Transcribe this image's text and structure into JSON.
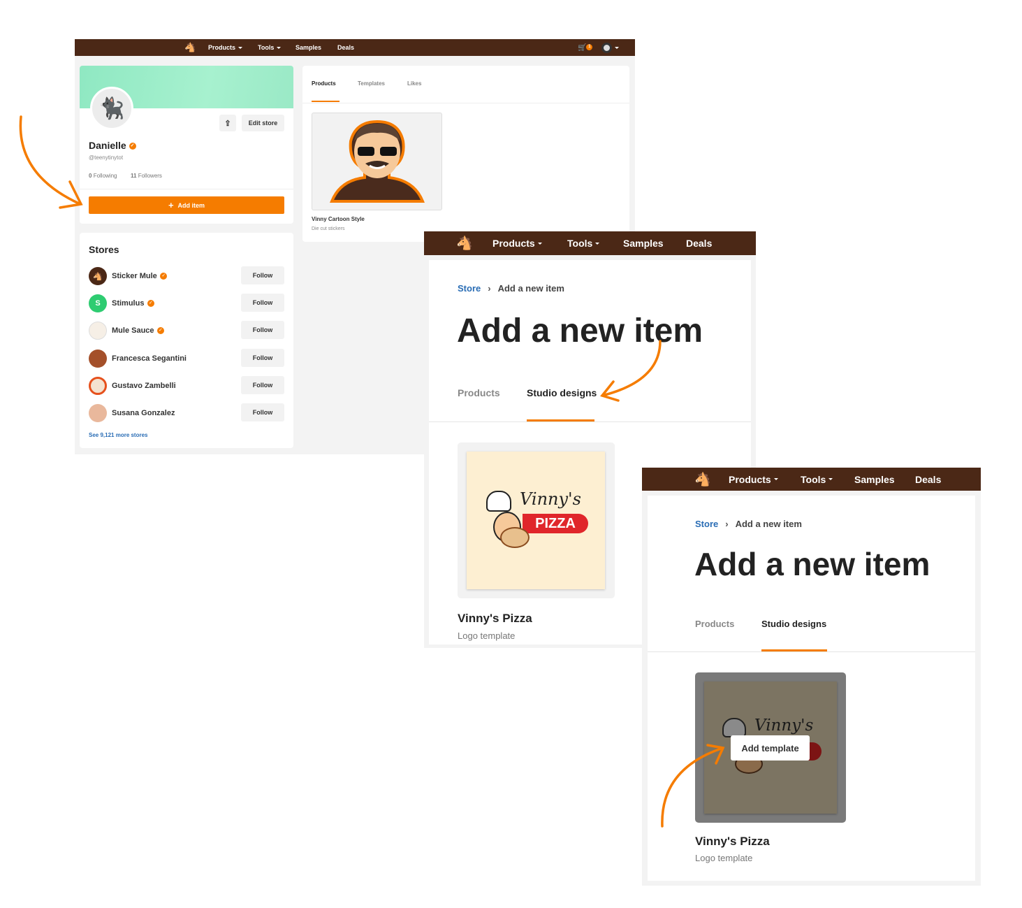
{
  "nav": {
    "items": [
      "Products",
      "Tools",
      "Samples",
      "Deals"
    ],
    "cart_count": "1",
    "brand_color": "#4b2816",
    "accent_color": "#f57c00"
  },
  "profile": {
    "name": "Danielle",
    "handle": "@teenytinytot",
    "following_count": "0",
    "following_label": "Following",
    "followers_count": "11",
    "followers_label": "Followers",
    "edit_store_label": "Edit store",
    "add_item_label": "Add item"
  },
  "stores": {
    "title": "Stores",
    "items": [
      {
        "name": "Sticker Mule",
        "verified": true,
        "follow_label": "Follow"
      },
      {
        "name": "Stimulus",
        "verified": true,
        "follow_label": "Follow"
      },
      {
        "name": "Mule Sauce",
        "verified": true,
        "follow_label": "Follow"
      },
      {
        "name": "Francesca Segantini",
        "verified": false,
        "follow_label": "Follow"
      },
      {
        "name": "Gustavo Zambelli",
        "verified": false,
        "follow_label": "Follow"
      },
      {
        "name": "Susana Gonzalez",
        "verified": false,
        "follow_label": "Follow"
      }
    ],
    "more_link": "See 9,121 more stores"
  },
  "store_tabs": {
    "tabs": [
      "Products",
      "Templates",
      "Likes"
    ],
    "active": "Products"
  },
  "product": {
    "title": "Vinny Cartoon Style",
    "subtitle": "Die cut stickers"
  },
  "add_item_page": {
    "breadcrumb_store": "Store",
    "breadcrumb_current": "Add a new item",
    "title": "Add a new item",
    "tabs": [
      "Products",
      "Studio designs"
    ],
    "active_tab": "Studio designs",
    "template": {
      "title": "Vinny's Pizza",
      "subtitle": "Logo template",
      "logo_script": "Vinny's",
      "logo_word": "PIZZA"
    },
    "hover_button": "Add template"
  }
}
